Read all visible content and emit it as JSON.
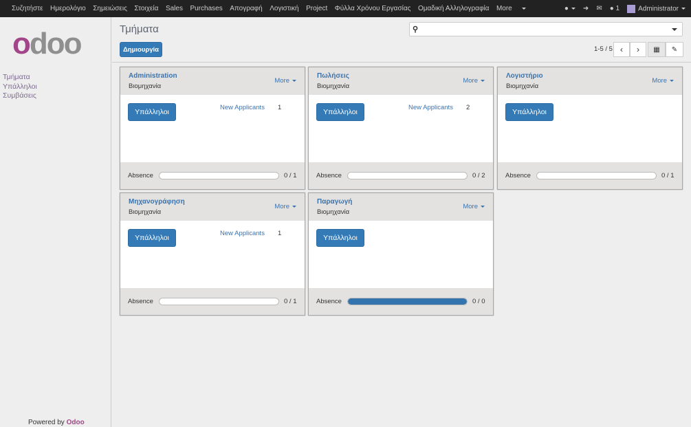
{
  "topbar": {
    "menu": [
      "Συζητήστε",
      "Ημερολόγιο",
      "Σημειώσεις",
      "Στοιχεία",
      "Sales",
      "Purchases",
      "Απογραφή",
      "Λογιστική",
      "Project",
      "Φύλλα Χρόνου Εργασίας",
      "Ομαδική Αλληλογραφία"
    ],
    "more": "More",
    "messages_count": "1",
    "user": "Administrator"
  },
  "sidebar": {
    "logo": "odoo",
    "items": [
      "Τμήματα",
      "Υπάλληλοι",
      "Συμβάσεις"
    ],
    "powered_prefix": "Powered by",
    "powered_brand": "Odoo"
  },
  "header": {
    "title": "Τμήματα",
    "create": "Δημιουργία",
    "search_placeholder": "",
    "pager": "1-5 / 5"
  },
  "colors": {
    "accent": "#337ab7",
    "topbar": "#222222",
    "brand": "#a24689"
  },
  "cards": [
    {
      "name": "Administration",
      "company": "Βιομηχανία",
      "more": "More",
      "button": "Υπάλληλοι",
      "applicants_label": "New Applicants",
      "applicants": "1",
      "absence_label": "Absence",
      "absence": "0 / 1",
      "absence_fraction": 0
    },
    {
      "name": "Πωλήσεις",
      "company": "Βιομηχανία",
      "more": "More",
      "button": "Υπάλληλοι",
      "applicants_label": "New Applicants",
      "applicants": "2",
      "absence_label": "Absence",
      "absence": "0 / 2",
      "absence_fraction": 0
    },
    {
      "name": "Λογιστήριο",
      "company": "Βιομηχανία",
      "more": "More",
      "button": "Υπάλληλοι",
      "absence_label": "Absence",
      "absence": "0 / 1",
      "absence_fraction": 0
    },
    {
      "name": "Μηχανογράφηση",
      "company": "Βιομηχανία",
      "more": "More",
      "button": "Υπάλληλοι",
      "applicants_label": "New Applicants",
      "applicants": "1",
      "absence_label": "Absence",
      "absence": "0 / 1",
      "absence_fraction": 0
    },
    {
      "name": "Παραγωγή",
      "company": "Βιομηχανία",
      "more": "More",
      "button": "Υπάλληλοι",
      "absence_label": "Absence",
      "absence": "0 / 0",
      "absence_fraction": 1
    }
  ]
}
